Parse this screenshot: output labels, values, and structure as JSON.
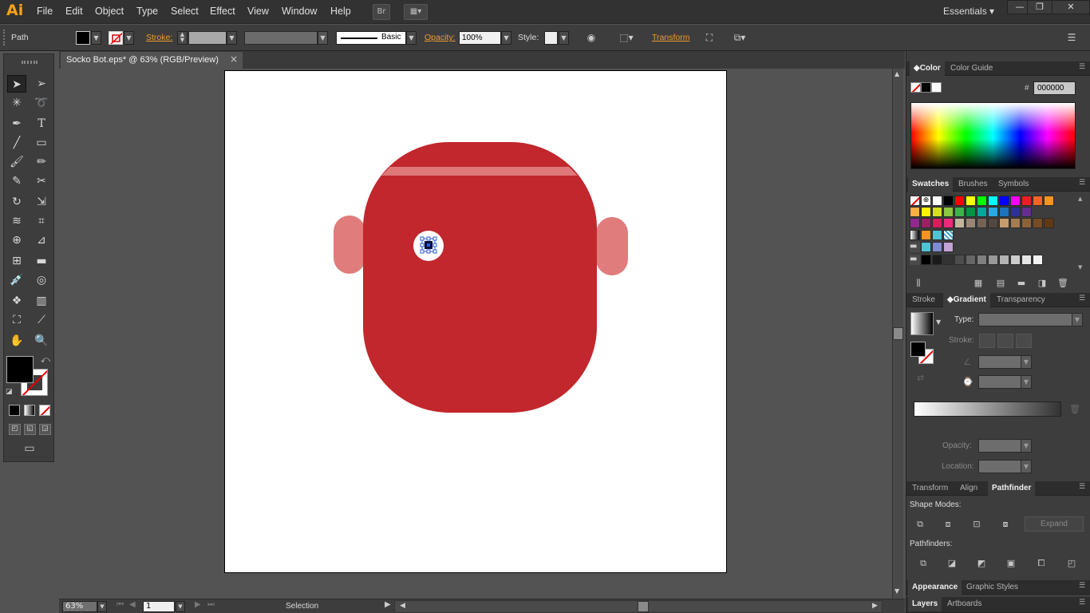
{
  "app": {
    "logo": "Ai",
    "menu": [
      "File",
      "Edit",
      "Object",
      "Type",
      "Select",
      "Effect",
      "View",
      "Window",
      "Help"
    ],
    "bridge_label": "Br",
    "workspace": "Essentials"
  },
  "control": {
    "selection_type": "Path",
    "stroke_label": "Stroke:",
    "brush_label": "Basic",
    "opacity_label": "Opacity:",
    "opacity_value": "100%",
    "style_label": "Style:",
    "transform_label": "Transform"
  },
  "document": {
    "tab_title": "Socko Bot.eps* @ 63% (RGB/Preview)",
    "close_glyph": "×"
  },
  "artwork": {
    "head_color": "#c1272d",
    "stripe_color": "#e07c7c",
    "ear_color": "#e07c7c",
    "eye_color": "#ffffff"
  },
  "panels": {
    "color_tabs": [
      "Color",
      "Color Guide"
    ],
    "hex_label": "#",
    "hex_value": "000000",
    "swatch_tabs": [
      "Swatches",
      "Brushes",
      "Symbols"
    ],
    "gradient_tabs": [
      "Stroke",
      "Gradient",
      "Transparency"
    ],
    "gradient_type_label": "Type:",
    "gradient_stroke_label": "Stroke:",
    "gradient_opacity_label": "Opacity:",
    "gradient_location_label": "Location:",
    "pathfinder_tabs": [
      "Transform",
      "Align",
      "Pathfinder"
    ],
    "shape_modes_label": "Shape Modes:",
    "expand_label": "Expand",
    "pathfinders_label": "Pathfinders:",
    "appearance_tabs": [
      "Appearance",
      "Graphic Styles"
    ],
    "layers_tabs": [
      "Layers",
      "Artboards"
    ]
  },
  "status": {
    "zoom": "63%",
    "artboard_number": "1",
    "tool_name": "Selection"
  },
  "swatches": {
    "row1": [
      "#ffffff",
      "#000000",
      "#ff0000",
      "#ffff00",
      "#00ff00",
      "#00ffff",
      "#0000ff",
      "#ff00ff",
      "#ed1c24",
      "#f26522",
      "#f7941d"
    ],
    "row2": [
      "#fbaf3f",
      "#fff200",
      "#d7df23",
      "#8dc63f",
      "#39b54a",
      "#009444",
      "#00a79d",
      "#27aae1",
      "#1c75bc",
      "#2e3192",
      "#662d91"
    ],
    "row3": [
      "#92278f",
      "#9e1f63",
      "#da1c5c",
      "#ee2a7b",
      "#c2b59b",
      "#998675",
      "#736357",
      "#534741",
      "#c69c6d",
      "#a67c52",
      "#8c6239",
      "#754c24",
      "#603913"
    ],
    "row6": [
      "#000000",
      "#1a1a1a",
      "#333333",
      "#4d4d4d",
      "#666666",
      "#808080",
      "#999999",
      "#b3b3b3",
      "#cccccc",
      "#e6e6e6",
      "#f2f2f2"
    ]
  }
}
